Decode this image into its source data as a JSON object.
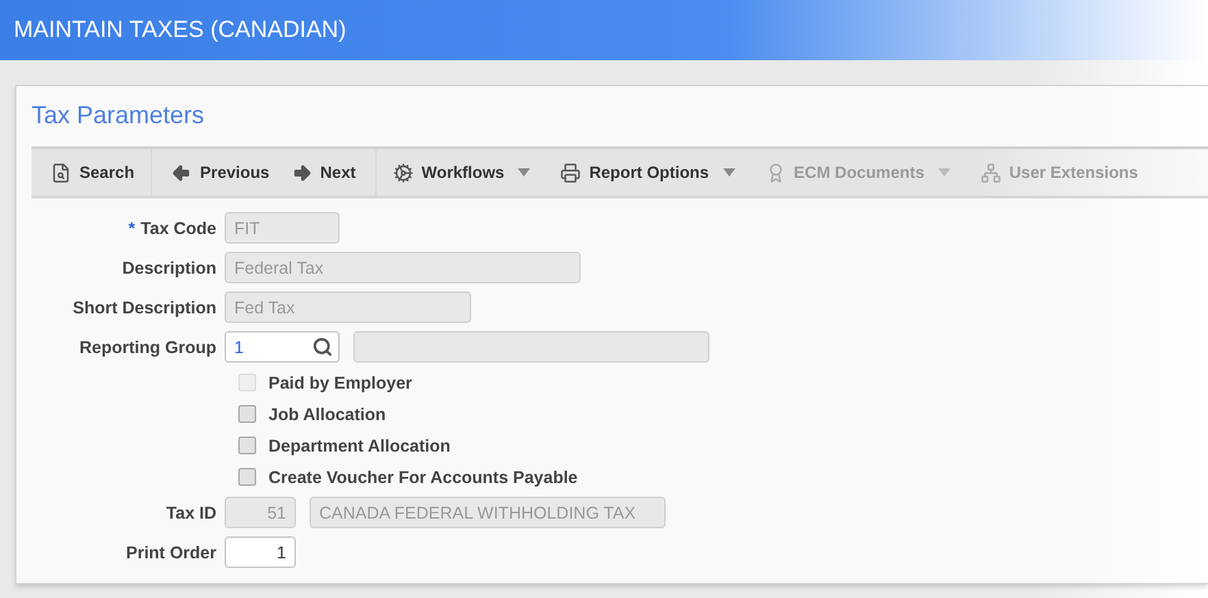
{
  "header": {
    "title": "MAINTAIN TAXES (CANADIAN)"
  },
  "panel": {
    "title": "Tax Parameters"
  },
  "toolbar": [
    {
      "label": "Search",
      "dropdown": false,
      "disabled": false
    },
    {
      "label": "Previous",
      "dropdown": false,
      "disabled": false
    },
    {
      "label": "Next",
      "dropdown": false,
      "disabled": false
    },
    {
      "label": "Workflows",
      "dropdown": true,
      "disabled": false
    },
    {
      "label": "Report Options",
      "dropdown": true,
      "disabled": false
    },
    {
      "label": "ECM Documents",
      "dropdown": true,
      "disabled": true
    },
    {
      "label": "User Extensions",
      "dropdown": false,
      "disabled": true
    }
  ],
  "form": [
    {
      "kind": "field",
      "required_mark": "*",
      "label": "Tax Code",
      "value": "FIT",
      "disabled": true
    },
    {
      "kind": "field",
      "label": "Description",
      "value": "Federal Tax",
      "disabled": true
    },
    {
      "kind": "field",
      "label": "Short Description",
      "value": "Fed Tax",
      "disabled": true
    },
    {
      "kind": "lookup",
      "label": "Reporting Group",
      "value": "1"
    },
    {
      "kind": "checkbox",
      "label": "Paid by Employer",
      "checked": false,
      "disabled": true
    },
    {
      "kind": "checkbox",
      "label": "Job Allocation",
      "checked": false,
      "disabled": false
    },
    {
      "kind": "checkbox",
      "label": "Department Allocation",
      "checked": false,
      "disabled": false
    },
    {
      "kind": "checkbox",
      "label": "Create Voucher For Accounts Payable",
      "checked": false,
      "disabled": false
    },
    {
      "kind": "pair",
      "label": "Tax ID",
      "value": "51",
      "disabled": true,
      "extra": "CANADA FEDERAL WITHHOLDING TAX"
    },
    {
      "kind": "number",
      "label": "Print Order",
      "value": "1",
      "disabled": false
    }
  ]
}
